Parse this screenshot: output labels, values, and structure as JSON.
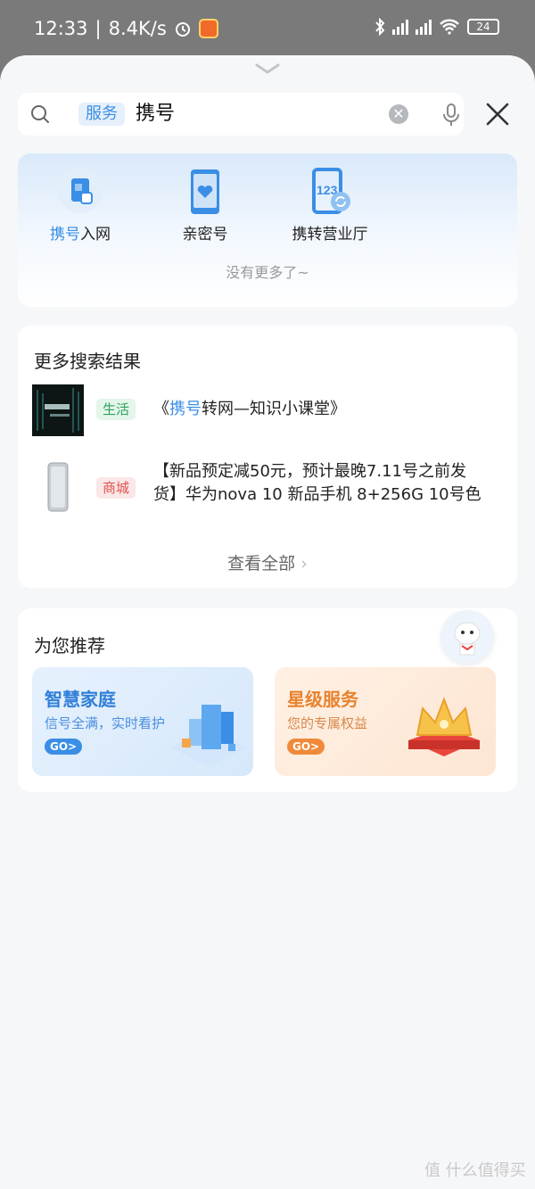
{
  "status_bar": {
    "time": "12:33",
    "speed": "8.4K/s",
    "battery": "24"
  },
  "search": {
    "scope_tag": "服务",
    "query": "携号"
  },
  "services": {
    "items": [
      {
        "label_highlight": "携号",
        "label_rest": "入网",
        "icon": "sim-card-icon"
      },
      {
        "label_highlight": "",
        "label_rest": "亲密号",
        "icon": "phone-heart-icon"
      },
      {
        "label_highlight": "",
        "label_rest": "携转营业厅",
        "icon": "phone-123-icon"
      }
    ],
    "no_more": "没有更多了~"
  },
  "results": {
    "title": "更多搜索结果",
    "items": [
      {
        "badge": "生活",
        "text_pre": "《",
        "text_hl": "携号",
        "text_post": "转网—知识小课堂》"
      },
      {
        "badge": "商城",
        "line1": "【新品预定减50元，预计最晚7.11号之前发",
        "line2": "货】华为nova 10 新品手机 8+256G 10号色"
      }
    ],
    "view_all": "查看全部"
  },
  "recommend": {
    "title": "为您推荐",
    "cards": [
      {
        "title": "智慧家庭",
        "subtitle": "信号全满，实时看护",
        "cta": "GO>"
      },
      {
        "title": "星级服务",
        "subtitle": "您的专属权益",
        "cta": "GO>"
      }
    ]
  },
  "watermark": "值 什么值得买"
}
